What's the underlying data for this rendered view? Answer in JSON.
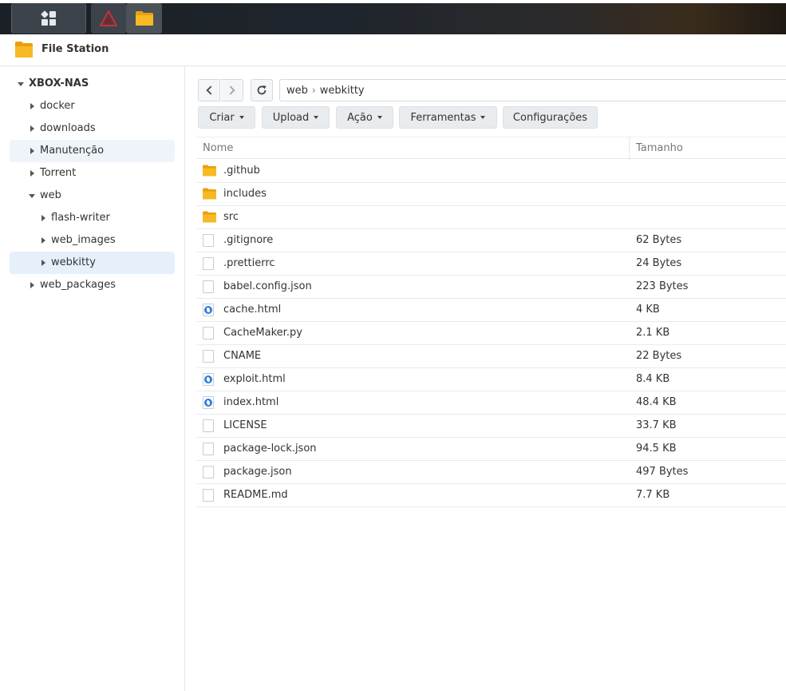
{
  "taskbar": {
    "main_icon": "grid-icon",
    "apps": [
      "triangle-app-icon",
      "folder-icon"
    ]
  },
  "window": {
    "title": "File Station"
  },
  "sidebar": {
    "root": "XBOX-NAS",
    "items": [
      {
        "label": "docker"
      },
      {
        "label": "downloads"
      },
      {
        "label": "Manutenção"
      },
      {
        "label": "Torrent"
      },
      {
        "label": "web"
      },
      {
        "label": "flash-writer"
      },
      {
        "label": "web_images"
      },
      {
        "label": "webkitty"
      },
      {
        "label": "web_packages"
      }
    ]
  },
  "path": {
    "crumbs": [
      "web",
      "webkitty"
    ]
  },
  "actions": {
    "create": "Criar",
    "upload": "Upload",
    "action": "Ação",
    "tools": "Ferramentas",
    "settings": "Configurações"
  },
  "list": {
    "col_name": "Nome",
    "col_size": "Tamanho",
    "files": [
      {
        "name": ".github",
        "size": "",
        "type": "folder"
      },
      {
        "name": "includes",
        "size": "",
        "type": "folder"
      },
      {
        "name": "src",
        "size": "",
        "type": "folder"
      },
      {
        "name": ".gitignore",
        "size": "62 Bytes",
        "type": "file"
      },
      {
        "name": ".prettierrc",
        "size": "24 Bytes",
        "type": "file"
      },
      {
        "name": "babel.config.json",
        "size": "223 Bytes",
        "type": "file"
      },
      {
        "name": "cache.html",
        "size": "4 KB",
        "type": "html"
      },
      {
        "name": "CacheMaker.py",
        "size": "2.1 KB",
        "type": "file"
      },
      {
        "name": "CNAME",
        "size": "22 Bytes",
        "type": "file"
      },
      {
        "name": "exploit.html",
        "size": "8.4 KB",
        "type": "html"
      },
      {
        "name": "index.html",
        "size": "48.4 KB",
        "type": "html"
      },
      {
        "name": "LICENSE",
        "size": "33.7 KB",
        "type": "file"
      },
      {
        "name": "package-lock.json",
        "size": "94.5 KB",
        "type": "file"
      },
      {
        "name": "package.json",
        "size": "497 Bytes",
        "type": "file"
      },
      {
        "name": "README.md",
        "size": "7.7 KB",
        "type": "file"
      }
    ]
  },
  "colors": {
    "folder": "#f7b924",
    "selected": "#e6f0fb",
    "html_icon": "#2f7fd6"
  }
}
